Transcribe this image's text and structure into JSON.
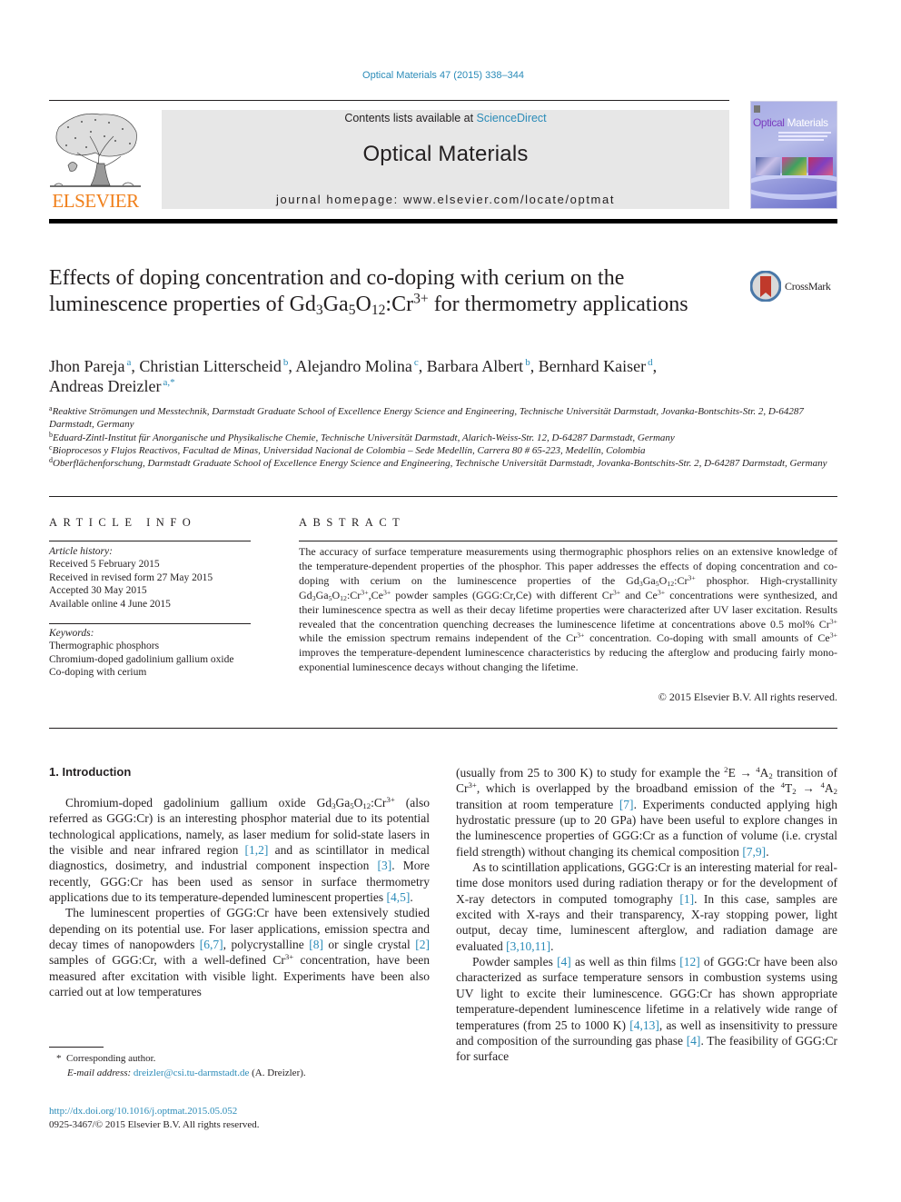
{
  "header": {
    "journal_citation": "Optical Materials 47 (2015) 338–344",
    "contents_prefix": "Contents lists available at ",
    "contents_link": "ScienceDirect",
    "journal_name": "Optical Materials",
    "homepage_prefix": "journal homepage: ",
    "homepage_url": "www.elsevier.com/locate/optmat",
    "publisher_wordmark": "ELSEVIER",
    "cover_title_part1": "Optical",
    "cover_title_part2": "Materials",
    "crossmark_label": "CrossMark",
    "colors": {
      "link": "#2a8bb8",
      "elsevier_orange": "#f07f1a",
      "header_box": "#e7e7e7"
    }
  },
  "article": {
    "title": [
      {
        "t": "Effects of doping concentration and co-doping with cerium on the luminescence properties of Gd"
      },
      {
        "sub": "3"
      },
      {
        "t": "Ga"
      },
      {
        "sub": "5"
      },
      {
        "t": "O"
      },
      {
        "sub": "12"
      },
      {
        "t": ":Cr"
      },
      {
        "sup": "3+"
      },
      {
        "t": " for thermometry applications"
      }
    ],
    "authors": [
      {
        "name": "Jhon Pareja",
        "aff": "a"
      },
      {
        "name": "Christian Litterscheid",
        "aff": "b"
      },
      {
        "name": "Alejandro Molina",
        "aff": "c"
      },
      {
        "name": "Barbara Albert",
        "aff": "b"
      },
      {
        "name": "Bernhard Kaiser",
        "aff": "d"
      },
      {
        "name": "Andreas Dreizler",
        "aff": "a,*"
      }
    ],
    "affiliations": [
      {
        "key": "a",
        "text": "Reaktive Strömungen und Messtechnik, Darmstadt Graduate School of Excellence Energy Science and Engineering, Technische Universität Darmstadt, Jovanka-Bontschits-Str. 2, D-64287 Darmstadt, Germany"
      },
      {
        "key": "b",
        "text": "Eduard-Zintl-Institut für Anorganische und Physikalische Chemie, Technische Universität Darmstadt, Alarich-Weiss-Str. 12, D-64287 Darmstadt, Germany"
      },
      {
        "key": "c",
        "text": "Bioprocesos y Flujos Reactivos, Facultad de Minas, Universidad Nacional de Colombia – Sede Medellín, Carrera 80 # 65-223, Medellín, Colombia"
      },
      {
        "key": "d",
        "text": "Oberflächenforschung, Darmstadt Graduate School of Excellence Energy Science and Engineering, Technische Universität Darmstadt, Jovanka-Bontschits-Str. 2, D-64287 Darmstadt, Germany"
      }
    ]
  },
  "article_info": {
    "heading": "ARTICLE INFO",
    "history_label": "Article history:",
    "history": [
      "Received 5 February 2015",
      "Received in revised form 27 May 2015",
      "Accepted 30 May 2015",
      "Available online 4 June 2015"
    ],
    "keywords_label": "Keywords:",
    "keywords": [
      "Thermographic phosphors",
      "Chromium-doped gadolinium gallium oxide",
      "Co-doping with cerium"
    ]
  },
  "abstract": {
    "heading": "ABSTRACT",
    "body": [
      {
        "t": "The accuracy of surface temperature measurements using thermographic phosphors relies on an extensive knowledge of the temperature-dependent properties of the phosphor. This paper addresses the effects of doping concentration and co-doping with cerium on the luminescence properties of the Gd"
      },
      {
        "sub": "3"
      },
      {
        "t": "Ga"
      },
      {
        "sub": "5"
      },
      {
        "t": "O"
      },
      {
        "sub": "12"
      },
      {
        "t": ":Cr"
      },
      {
        "sup": "3+"
      },
      {
        "t": " phosphor. High-crystallinity Gd"
      },
      {
        "sub": "3"
      },
      {
        "t": "Ga"
      },
      {
        "sub": "5"
      },
      {
        "t": "O"
      },
      {
        "sub": "12"
      },
      {
        "t": ":Cr"
      },
      {
        "sup": "3+"
      },
      {
        "t": ",Ce"
      },
      {
        "sup": "3+"
      },
      {
        "t": " powder samples (GGG:Cr,Ce) with different Cr"
      },
      {
        "sup": "3+"
      },
      {
        "t": " and Ce"
      },
      {
        "sup": "3+"
      },
      {
        "t": " concentrations were synthesized, and their luminescence spectra as well as their decay lifetime properties were characterized after UV laser excitation. Results revealed that the concentration quenching decreases the luminescence lifetime at concentrations above 0.5 mol% Cr"
      },
      {
        "sup": "3+"
      },
      {
        "t": " while the emission spectrum remains independent of the Cr"
      },
      {
        "sup": "3+"
      },
      {
        "t": " concentration. Co-doping with small amounts of Ce"
      },
      {
        "sup": "3+"
      },
      {
        "t": " improves the temperature-dependent luminescence characteristics by reducing the afterglow and producing fairly mono-exponential luminescence decays without changing the lifetime."
      }
    ],
    "copyright": "© 2015 Elsevier B.V. All rights reserved."
  },
  "body": {
    "section_heading": "1. Introduction",
    "left_paragraphs": [
      [
        {
          "t": "Chromium-doped gadolinium gallium oxide Gd"
        },
        {
          "sub": "3"
        },
        {
          "t": "Ga"
        },
        {
          "sub": "5"
        },
        {
          "t": "O"
        },
        {
          "sub": "12"
        },
        {
          "t": ":Cr"
        },
        {
          "sup": "3+"
        },
        {
          "t": " (also referred as GGG:Cr) is an interesting phosphor material due to its potential technological applications, namely, as laser medium for solid-state lasers in the visible and near infrared region "
        },
        {
          "ref": "[1,2]"
        },
        {
          "t": " and as scintillator in medical diagnostics, dosimetry, and industrial component inspection "
        },
        {
          "ref": "[3]"
        },
        {
          "t": ". More recently, GGG:Cr has been used as sensor in surface thermometry applications due to its temperature-depended luminescent properties "
        },
        {
          "ref": "[4,5]"
        },
        {
          "t": "."
        }
      ],
      [
        {
          "t": "The luminescent properties of GGG:Cr have been extensively studied depending on its potential use. For laser applications, emission spectra and decay times of nanopowders "
        },
        {
          "ref": "[6,7]"
        },
        {
          "t": ", polycrystalline "
        },
        {
          "ref": "[8]"
        },
        {
          "t": " or single crystal "
        },
        {
          "ref": "[2]"
        },
        {
          "t": " samples of GGG:Cr, with a well-defined Cr"
        },
        {
          "sup": "3+"
        },
        {
          "t": " concentration, have been measured after excitation with visible light. Experiments have been also carried out at low temperatures"
        }
      ]
    ],
    "right_paragraphs": [
      [
        {
          "t": "(usually from 25 to 300 K) to study for example the "
        },
        {
          "sup": "2"
        },
        {
          "t": "E → "
        },
        {
          "sup": "4"
        },
        {
          "t": "A"
        },
        {
          "sub": "2"
        },
        {
          "t": " transition of Cr"
        },
        {
          "sup": "3+"
        },
        {
          "t": ", which is overlapped by the broadband emission of the "
        },
        {
          "sup": "4"
        },
        {
          "t": "T"
        },
        {
          "sub": "2"
        },
        {
          "t": " → "
        },
        {
          "sup": "4"
        },
        {
          "t": "A"
        },
        {
          "sub": "2"
        },
        {
          "t": " transition at room temperature "
        },
        {
          "ref": "[7]"
        },
        {
          "t": ". Experiments conducted applying high hydrostatic pressure (up to 20 GPa) have been useful to explore changes in the luminescence properties of GGG:Cr as a function of volume (i.e. crystal field strength) without changing its chemical composition "
        },
        {
          "ref": "[7,9]"
        },
        {
          "t": "."
        }
      ],
      [
        {
          "t": "As to scintillation applications, GGG:Cr is an interesting material for real-time dose monitors used during radiation therapy or for the development of X-ray detectors in computed tomography "
        },
        {
          "ref": "[1]"
        },
        {
          "t": ". In this case, samples are excited with X-rays and their transparency, X-ray stopping power, light output, decay time, luminescent afterglow, and radiation damage are evaluated "
        },
        {
          "ref": "[3,10,11]"
        },
        {
          "t": "."
        }
      ],
      [
        {
          "t": "Powder samples "
        },
        {
          "ref": "[4]"
        },
        {
          "t": " as well as thin films "
        },
        {
          "ref": "[12]"
        },
        {
          "t": " of GGG:Cr have been also characterized as surface temperature sensors in combustion systems using UV light to excite their luminescence. GGG:Cr has shown appropriate temperature-dependent luminescence lifetime in a relatively wide range of temperatures (from 25 to 1000 K) "
        },
        {
          "ref": "[4,13]"
        },
        {
          "t": ", as well as insensitivity to pressure and composition of the surrounding gas phase "
        },
        {
          "ref": "[4]"
        },
        {
          "t": ". The feasibility of GGG:Cr for surface"
        }
      ]
    ]
  },
  "footnotes": {
    "corresponding_marker": "*",
    "corresponding_text": "Corresponding author.",
    "email_label": "E-mail address: ",
    "email": "dreizler@csi.tu-darmstadt.de",
    "email_suffix": " (A. Dreizler)."
  },
  "doi": {
    "url": "http://dx.doi.org/10.1016/j.optmat.2015.05.052",
    "issn_line": "0925-3467/© 2015 Elsevier B.V. All rights reserved."
  }
}
